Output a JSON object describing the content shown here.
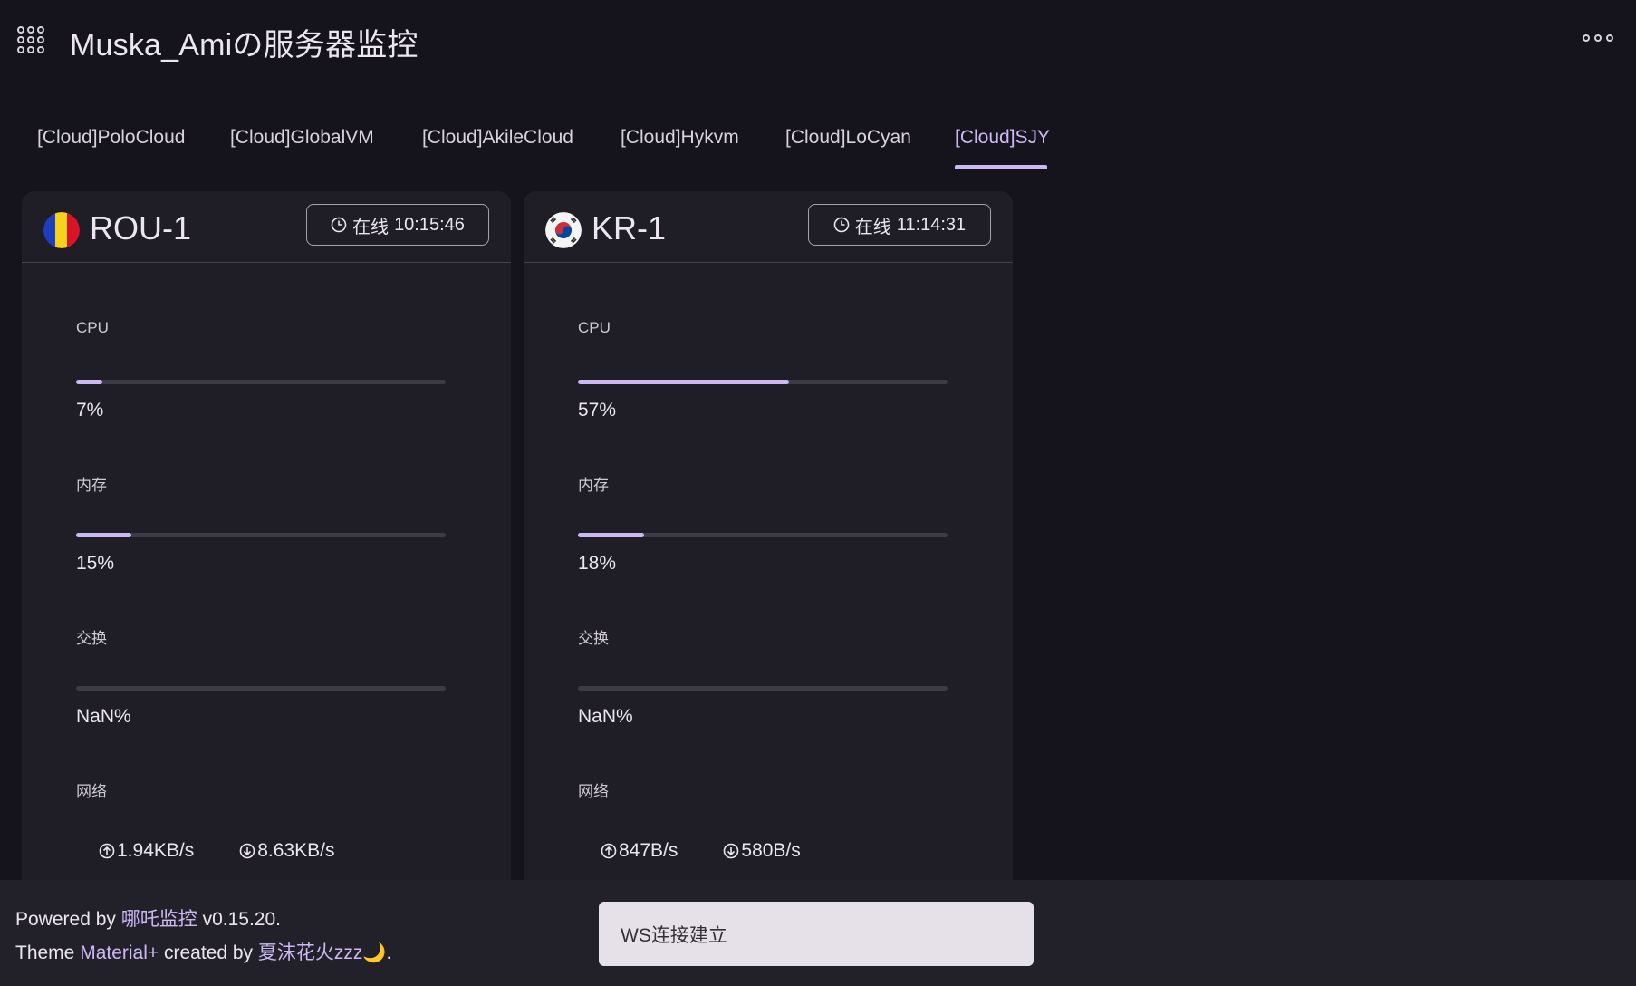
{
  "app": {
    "title": "Muska_Amiの服务器监控"
  },
  "tabs": [
    {
      "label": "[Cloud]PoloCloud"
    },
    {
      "label": "[Cloud]GlobalVM"
    },
    {
      "label": "[Cloud]AkileCloud"
    },
    {
      "label": "[Cloud]Hykvm"
    },
    {
      "label": "[Cloud]LoCyan"
    },
    {
      "label": "[Cloud]SJY"
    }
  ],
  "active_tab": 5,
  "servers": [
    {
      "name": "ROU-1",
      "status": "在线",
      "uptime": "10:15:46",
      "flag": "romania-flag",
      "cpu": {
        "label": "CPU",
        "value": "7%",
        "percent": 7
      },
      "memory": {
        "label": "内存",
        "value": "15%",
        "percent": 15
      },
      "swap": {
        "label": "交换",
        "value": "NaN%",
        "percent": 0
      },
      "network": {
        "label": "网络",
        "up": "1.94KB/s",
        "down": "8.63KB/s"
      }
    },
    {
      "name": "KR-1",
      "status": "在线",
      "uptime": "11:14:31",
      "flag": "south-korea-flag",
      "cpu": {
        "label": "CPU",
        "value": "57%",
        "percent": 57
      },
      "memory": {
        "label": "内存",
        "value": "18%",
        "percent": 18
      },
      "swap": {
        "label": "交换",
        "value": "NaN%",
        "percent": 0
      },
      "network": {
        "label": "网络",
        "up": "847B/s",
        "down": "580B/s"
      }
    }
  ],
  "footer": {
    "powered_prefix": "Powered by ",
    "powered_link": "哪吒监控",
    "version": " v0.15.20.",
    "theme_prefix": "Theme ",
    "theme_link": "Material+",
    "created_by": " created by ",
    "author_link": "夏沫花火zzz",
    "moon": "🌙",
    "end": "."
  },
  "snackbar": {
    "message": "WS连接建立"
  },
  "colors": {
    "accent": "#cdb8f6",
    "background": "#15141c",
    "card": "#1f1e26"
  }
}
